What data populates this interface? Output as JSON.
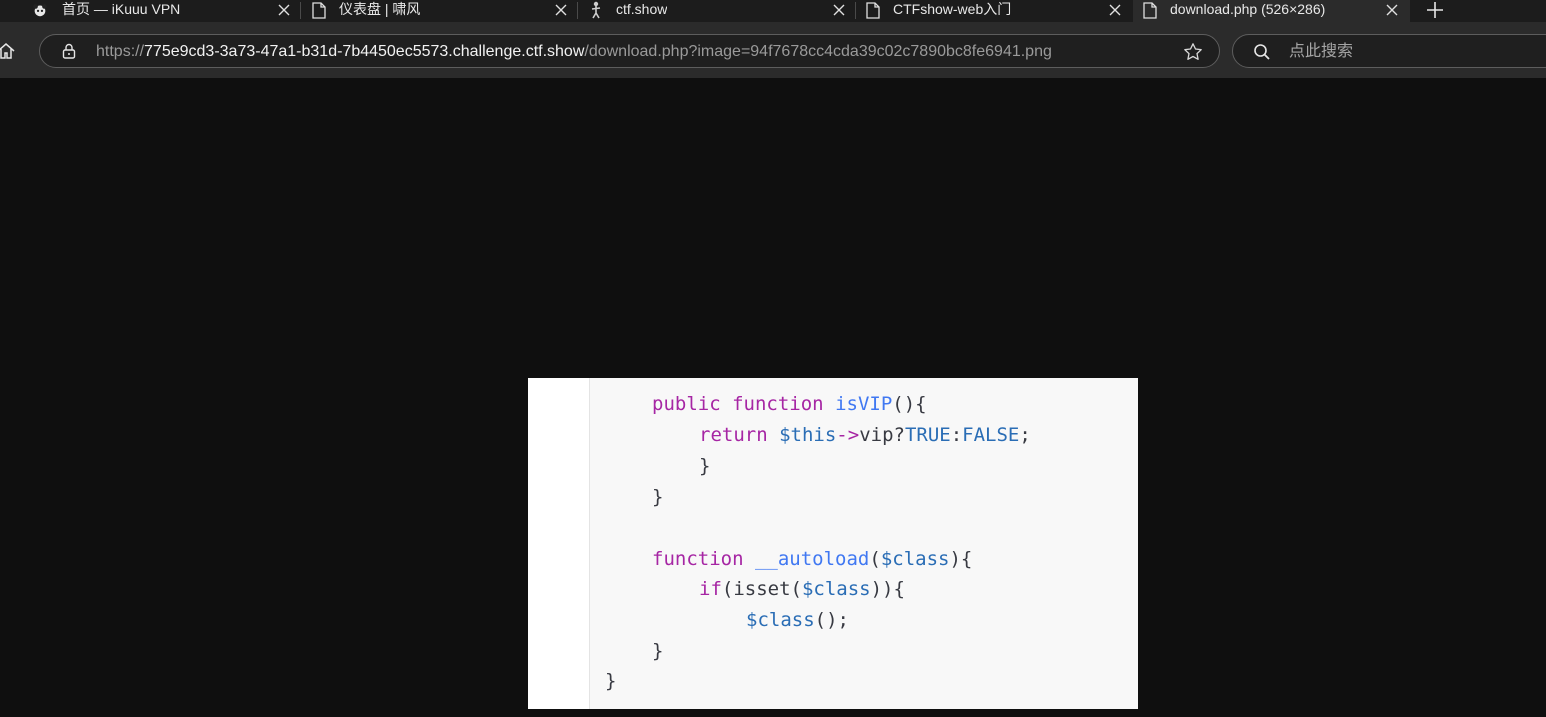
{
  "tabs": [
    {
      "icon": "panda-icon",
      "title": "首页 — iKuuu VPN",
      "active": false
    },
    {
      "icon": "page-icon",
      "title": "仪表盘 | 啸风",
      "active": false
    },
    {
      "icon": "figure-icon",
      "title": "ctf.show",
      "active": false
    },
    {
      "icon": "page-icon",
      "title": "CTFshow-web入门",
      "active": false
    },
    {
      "icon": "page-icon",
      "title": "download.php (526×286)",
      "active": true
    }
  ],
  "toolbar": {
    "url_scheme": "https://",
    "url_host": "775e9cd3-3a73-47a1-b31d-7b4450ec5573.challenge.ctf.show",
    "url_path": "/download.php?image=94f7678cc4cda39c02c7890bc8fe6941.png",
    "search_placeholder": "点此搜索"
  },
  "code": {
    "l1_kw1": "public",
    "l1_kw2": "function",
    "l1_fn": "isVIP",
    "l1_rest": "(){",
    "l2_kw": "return",
    "l2_var": "$this",
    "l2_arrow": "->",
    "l2_prop": "vip?",
    "l2_true": "TRUE",
    "l2_colon": ":",
    "l2_false": "FALSE",
    "l2_end": ";",
    "l3": "}",
    "l4": "}",
    "l6_kw": "function",
    "l6_fn": "__autoload",
    "l6_open": "(",
    "l6_var": "$class",
    "l6_close": "){",
    "l7_kw": "if",
    "l7_open": "(isset(",
    "l7_var": "$class",
    "l7_close": ")){",
    "l8_var": "$class",
    "l8_rest": "();",
    "l9": "}",
    "l10": "}"
  },
  "colors": {
    "keyword": "#a626a4",
    "function": "#4078f2",
    "variable": "#2a6db5",
    "page_background": "#101010"
  }
}
